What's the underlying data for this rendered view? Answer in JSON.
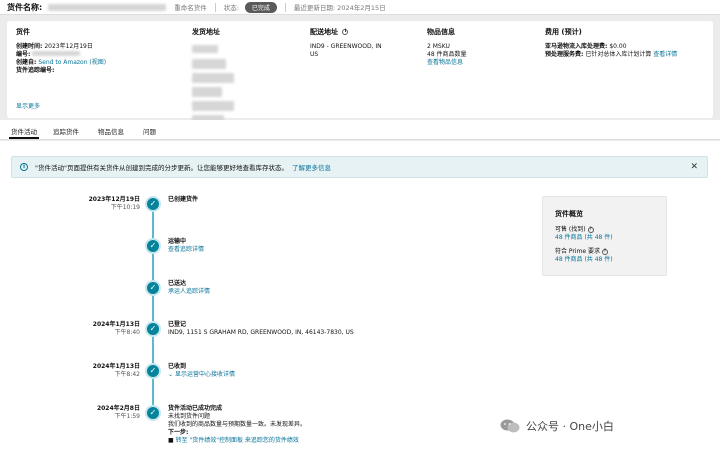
{
  "header": {
    "title": "货件名称:",
    "rename_label": "重命名货件",
    "status_label": "状态:",
    "status_value": "已完成",
    "last_updated": "最近更新日期: 2024年2月15日"
  },
  "info": {
    "shipment": {
      "title": "货件",
      "created_label": "创建时间:",
      "created_value": "2023年12月19日",
      "number_label": "编号:",
      "created_by_label": "创建自:",
      "created_by_value": "Send to Amazon (视图)",
      "tracking_label": "货件追踪编号:",
      "show_more": "显示更多"
    },
    "ship_from": {
      "title": "发货地址"
    },
    "ship_to": {
      "title": "配送地址",
      "line1": "IND9 - GREENWOOD, IN",
      "line2": "US"
    },
    "contents": {
      "title": "物品信息",
      "msku": "2 MSKU",
      "units": "48 件商品数量",
      "link": "查看物品信息"
    },
    "fees": {
      "title": "费用 (预计)",
      "label1": "亚马逊物流入库处理费:",
      "value1": "$0.00",
      "label2": "预处理服务费:",
      "value2": "已针对总体入库计划计算",
      "link2": "查看详情"
    }
  },
  "tabs": [
    "货件活动",
    "追踪货件",
    "物品信息",
    "问题"
  ],
  "banner": {
    "text": "\"货件活动\"页面提供有关货件从创建到完成的分步更新。让您能够更好地查看库存状态。",
    "link": "了解更多信息"
  },
  "timeline": [
    {
      "date": "2023年12月19日",
      "time": "下午10:19",
      "title": "已创建货件",
      "detail": ""
    },
    {
      "date": "",
      "time": "",
      "title": "运输中",
      "detail": "查看追踪详情"
    },
    {
      "date": "",
      "time": "",
      "title": "已送达",
      "detail": "承运人追踪详情"
    },
    {
      "date": "2024年1月13日",
      "time": "下午8:40",
      "title": "已登记",
      "detail": "IND9, 1151 S GRAHAM RD, GREENWOOD, IN, 46143-7830, US"
    },
    {
      "date": "2024年1月13日",
      "time": "下午8:42",
      "title": "已收到",
      "detail": "显示运营中心接收详情"
    },
    {
      "date": "2024年2月8日",
      "time": "下午1:59",
      "title": "货件活动已成功完成",
      "detail": "未找到货件问题",
      "detail2": "我们收到的商品数量与预期数量一致。未发现差异。",
      "next_label": "下一步:",
      "next_item": "转至 \"货件绩效\"控制面板 来追踪您的货件绩效"
    }
  ],
  "summary": {
    "title": "货件概览",
    "available_label": "可售 (找到)",
    "available_value": "48 件商品 (共 48 件)",
    "prime_label": "符合 Prime 要求",
    "prime_value": "48 件商品 (共 48 件)"
  },
  "watermark": "公众号 · One小白"
}
